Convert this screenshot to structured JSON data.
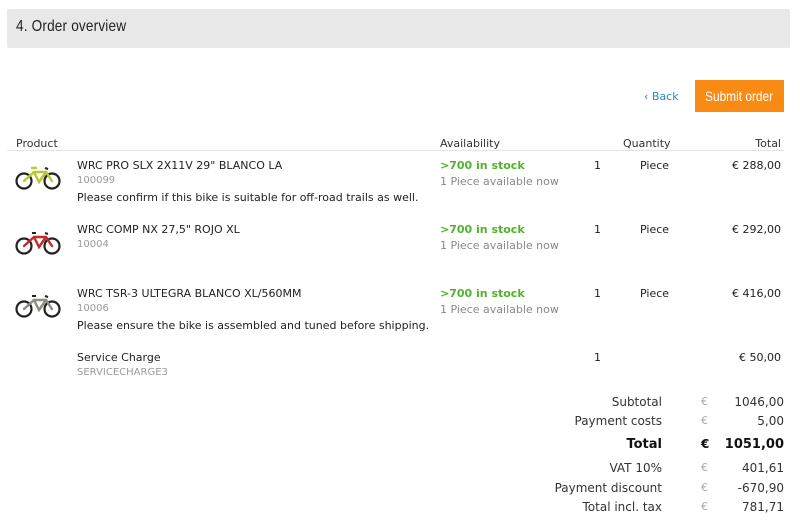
{
  "header": {
    "title": "4.  Order overview"
  },
  "actions": {
    "back_label": "‹ Back",
    "submit_label": "Submit order"
  },
  "columns": {
    "product": "Product",
    "availability": "Availability",
    "quantity": "Quantity",
    "total": "Total"
  },
  "colors": {
    "accent": "#f98a14",
    "link": "#2b85c5",
    "in_stock": "#53b02f"
  },
  "items": [
    {
      "name": "WRC PRO SLX 2X11V 29\" BLANCO LA",
      "number": "100099",
      "note": "Please confirm if this bike is suitable for off-road trails as well.",
      "stock": ">700 in stock",
      "available": "1 Piece available now",
      "qty": "1",
      "unit": "Piece",
      "price": "€ 288,00",
      "icon": "bike-yellow-icon"
    },
    {
      "name": "WRC COMP NX 27,5\" ROJO XL",
      "number": "10004",
      "note": "",
      "stock": ">700 in stock",
      "available": "1 Piece available now",
      "qty": "1",
      "unit": "Piece",
      "price": "€ 292,00",
      "icon": "bike-red-icon"
    },
    {
      "name": "WRC TSR-3 ULTEGRA BLANCO XL/560MM",
      "number": "10006",
      "note": "Please ensure the bike is assembled and tuned before shipping.",
      "stock": ">700 in stock",
      "available": "1 Piece available now",
      "qty": "1",
      "unit": "Piece",
      "price": "€ 416,00",
      "icon": "bike-white-icon"
    },
    {
      "name": "Service Charge",
      "number": "SERVICECHARGE3",
      "note": "",
      "stock": "",
      "available": "",
      "qty": "1",
      "unit": "",
      "price": "€ 50,00",
      "icon": ""
    }
  ],
  "summary": {
    "currency": "€",
    "subtotal": {
      "label": "Subtotal",
      "value": "1046,00"
    },
    "payment_costs": {
      "label": "Payment costs",
      "value": "5,00"
    },
    "total": {
      "label": "Total",
      "value": "1051,00"
    },
    "vat": {
      "label": "VAT 10%",
      "value": "401,61"
    },
    "payment_discount": {
      "label": "Payment discount",
      "value": "-670,90"
    },
    "total_incl_tax": {
      "label": "Total incl. tax",
      "value": "781,71"
    }
  }
}
